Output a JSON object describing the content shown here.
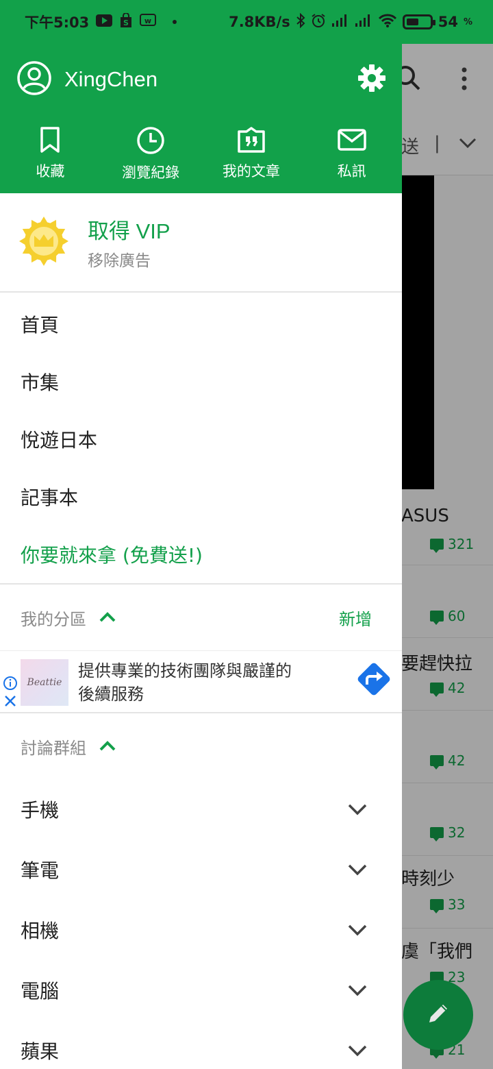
{
  "status_bar": {
    "time": "下午5:03",
    "speed": "7.8KB/s",
    "battery": "54",
    "battery_unit": "%",
    "battery_level": 0.54
  },
  "background": {
    "tab_fragment_1": "送",
    "tab_fragment_2": "|",
    "snippets": [
      "ASUS",
      "要趕快拉",
      "時刻少",
      "虞「我們"
    ],
    "comment_counts": [
      "321",
      "60",
      "42",
      "42",
      "32",
      "33",
      "23",
      "21"
    ]
  },
  "drawer": {
    "user_name": "XingChen",
    "quick_actions": [
      {
        "label": "收藏",
        "icon": "bookmark-icon"
      },
      {
        "label": "瀏覽紀錄",
        "icon": "history-icon"
      },
      {
        "label": "我的文章",
        "icon": "article-quote-icon"
      },
      {
        "label": "私訊",
        "icon": "mail-icon"
      }
    ],
    "vip": {
      "title": "取得 VIP",
      "subtitle": "移除廣告"
    },
    "menu": [
      "首頁",
      "市集",
      "悅遊日本",
      "記事本",
      "你要就來拿 (免費送!)"
    ],
    "my_section": {
      "title": "我的分區",
      "add_label": "新增"
    },
    "ad": {
      "logo_text": "Beattie",
      "text_line1": "提供專業的技術團隊與嚴謹的",
      "text_line2": "後續服務"
    },
    "groups_section": {
      "title": "討論群組",
      "items": [
        "手機",
        "筆電",
        "相機",
        "電腦",
        "蘋果"
      ]
    }
  },
  "colors": {
    "accent": "#12a14a",
    "accent_dark": "#0d7c3b",
    "vip_gold": "#f5cf2e",
    "ad_blue": "#1a73e8"
  }
}
